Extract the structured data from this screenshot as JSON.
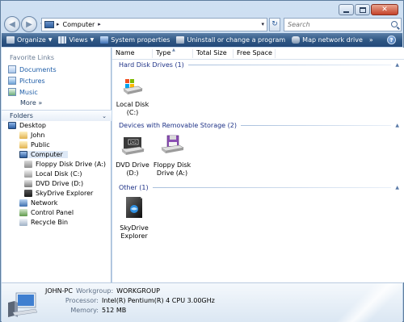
{
  "address": {
    "crumb": "Computer"
  },
  "search": {
    "placeholder": "Search"
  },
  "toolbar": {
    "organize": "Organize",
    "views": "Views",
    "system_properties": "System properties",
    "uninstall": "Uninstall or change a program",
    "map_network": "Map network drive",
    "overflow": "»"
  },
  "navpane": {
    "favorites_title": "Favorite Links",
    "favorites": [
      "Documents",
      "Pictures",
      "Music"
    ],
    "more": "More",
    "folders_title": "Folders",
    "tree": [
      "Desktop",
      "John",
      "Public",
      "Computer",
      "Floppy Disk Drive (A:)",
      "Local Disk (C:)",
      "DVD Drive (D:)",
      "SkyDrive Explorer",
      "Network",
      "Control Panel",
      "Recycle Bin"
    ]
  },
  "columns": [
    "Name",
    "Type",
    "Total Size",
    "Free Space"
  ],
  "groups": {
    "hdd": "Hard Disk Drives (1)",
    "removable": "Devices with Removable Storage (2)",
    "other": "Other (1)"
  },
  "items": {
    "local_disk": [
      "Local Disk",
      "(C:)"
    ],
    "dvd": [
      "DVD Drive",
      "(D:)"
    ],
    "floppy": [
      "Floppy Disk",
      "Drive (A:)"
    ],
    "skydrive": [
      "SkyDrive",
      "Explorer"
    ]
  },
  "details": {
    "computer_name": "JOHN-PC",
    "workgroup_label": "Workgroup:",
    "workgroup": "WORKGROUP",
    "processor_label": "Processor:",
    "processor": "Intel(R) Pentium(R) 4 CPU 3.00GHz",
    "memory_label": "Memory:",
    "memory": "512 MB"
  },
  "colors": {
    "toolbar": "#2e5683",
    "link": "#1f5ea8",
    "group_header": "#1e3287"
  }
}
